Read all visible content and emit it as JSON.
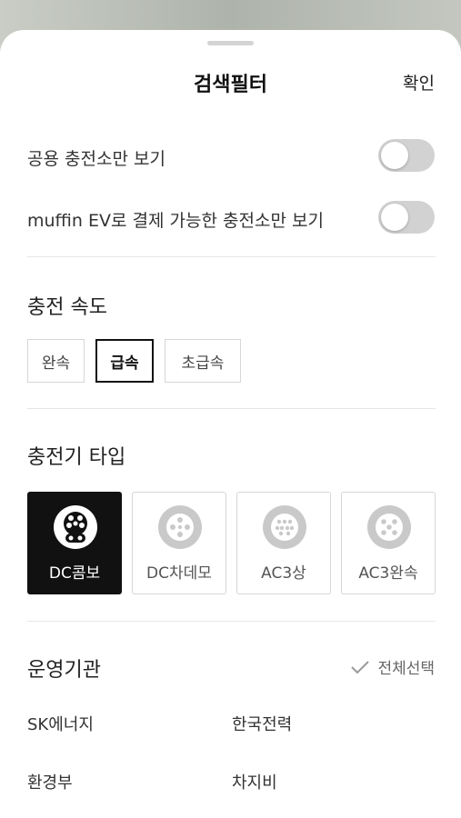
{
  "header": {
    "title": "검색필터",
    "confirm_label": "확인"
  },
  "toggles": [
    {
      "label": "공용 충전소만 보기",
      "on": false
    },
    {
      "label": "muffin EV로 결제 가능한 충전소만 보기",
      "on": false
    }
  ],
  "speed": {
    "title": "충전 속도",
    "options": [
      "완속",
      "급속",
      "초급속"
    ],
    "selected": "급속"
  },
  "charger_type": {
    "title": "충전기 타입",
    "options": [
      {
        "label": "DC콤보",
        "icon": "dc-combo-connector-icon",
        "selected": true
      },
      {
        "label": "DC차데모",
        "icon": "dc-chademo-connector-icon",
        "selected": false
      },
      {
        "label": "AC3상",
        "icon": "ac3-phase-connector-icon",
        "selected": false
      },
      {
        "label": "AC3완속",
        "icon": "ac3-slow-connector-icon",
        "selected": false
      }
    ]
  },
  "operators": {
    "title": "운영기관",
    "select_all_label": "전체선택",
    "items": [
      "SK에너지",
      "한국전력",
      "환경부",
      "차지비"
    ]
  },
  "colors": {
    "accent": "#111111",
    "toggle_off": "#d2d2d2",
    "icon_gray": "#c9c9c9",
    "divider": "#e6e6e6"
  }
}
